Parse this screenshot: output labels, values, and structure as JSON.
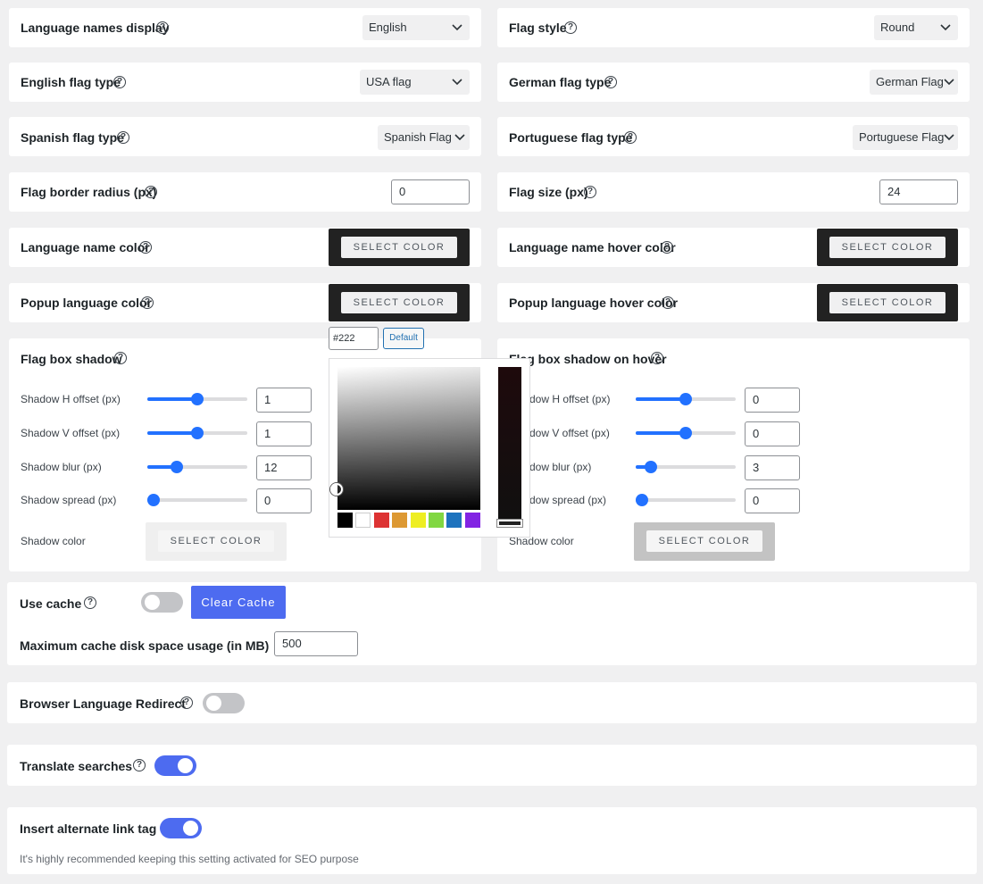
{
  "rows": {
    "language_names_display": {
      "label": "Language names display",
      "value": "English"
    },
    "flag_style": {
      "label": "Flag style",
      "value": "Round"
    },
    "english_flag_type": {
      "label": "English flag type",
      "value": "USA flag"
    },
    "german_flag_type": {
      "label": "German flag type",
      "value": "German Flag"
    },
    "spanish_flag_type": {
      "label": "Spanish flag type",
      "value": "Spanish Flag"
    },
    "portuguese_flag_type": {
      "label": "Portuguese flag type",
      "value": "Portuguese Flag"
    },
    "flag_border_radius": {
      "label": "Flag border radius (px)",
      "value": "0"
    },
    "flag_size": {
      "label": "Flag size (px)",
      "value": "24"
    },
    "language_name_color": {
      "label": "Language name color",
      "button": "SELECT COLOR"
    },
    "language_name_hover_color": {
      "label": "Language name hover color",
      "button": "SELECT COLOR"
    },
    "popup_language_color": {
      "label": "Popup language color",
      "button": "SELECT COLOR"
    },
    "popup_language_hover_color": {
      "label": "Popup language hover color",
      "button": "SELECT COLOR"
    }
  },
  "color_picker": {
    "hex_value": "#222",
    "default_label": "Default",
    "swatches": [
      "#000000",
      "#ffffff",
      "#dd3333",
      "#dd9933",
      "#eeee22",
      "#81d742",
      "#1e73be",
      "#8224e3"
    ]
  },
  "shadow": {
    "title": "Flag box shadow",
    "h_label": "Shadow H offset (px)",
    "h_value": "1",
    "h_level": 0.5,
    "v_label": "Shadow V offset (px)",
    "v_value": "1",
    "v_level": 0.5,
    "blur_label": "Shadow blur (px)",
    "blur_value": "12",
    "blur_level": 0.27,
    "spread_label": "Shadow spread (px)",
    "spread_value": "0",
    "spread_level": 0.0,
    "color_label": "Shadow color",
    "color_button": "SELECT COLOR"
  },
  "shadow_hover": {
    "title": "Flag box shadow on hover",
    "h_label": "dow H offset (px)",
    "h_value": "0",
    "h_level": 0.5,
    "v_label": "dow V offset (px)",
    "v_value": "0",
    "v_level": 0.5,
    "blur_label": "dow blur (px)",
    "blur_value": "3",
    "blur_level": 0.1,
    "spread_label": "dow spread (px)",
    "spread_value": "0",
    "spread_level": 0.0,
    "color_label": "Shadow color",
    "color_button": "SELECT COLOR"
  },
  "cache": {
    "use_cache_label": "Use cache",
    "use_cache_on": false,
    "clear_cache_label": "Clear Cache",
    "max_label": "Maximum cache disk space usage (in MB)",
    "max_value": "500"
  },
  "browser_redirect": {
    "label": "Browser Language Redirect",
    "on": false
  },
  "translate_searches": {
    "label": "Translate searches",
    "on": true
  },
  "alternate_link": {
    "label": "Insert alternate link tag",
    "on": true,
    "hint": "It's highly recommended keeping this setting activated for SEO purpose"
  },
  "colors": {
    "accent": "#4d6bf0",
    "slider": "#2271ff",
    "swatch_dark": "#222222"
  }
}
